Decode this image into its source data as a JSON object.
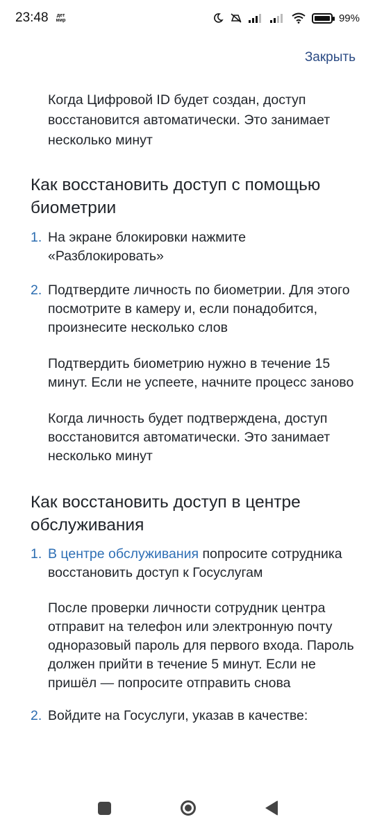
{
  "status_bar": {
    "time": "23:48",
    "notification_label": "дет мир",
    "battery": "99%"
  },
  "header": {
    "close_label": "Закрыть"
  },
  "intro": "Когда Цифровой ID будет создан, доступ восстановится автоматически. Это занимает несколько минут",
  "biometrics": {
    "heading": "Как восстановить доступ с помощью биометрии",
    "steps": [
      {
        "num": "1.",
        "text": "На экране блокировки нажмите «Разблокировать»"
      },
      {
        "num": "2.",
        "text": "Подтвердите личность по биометрии. Для этого посмотрите в камеру и, если понадобится, произнесите несколько слов"
      }
    ],
    "notes": [
      "Подтвердить биометрию нужно в течение 15 минут. Если не успеете, начните процесс заново",
      "Когда личность будет подтверждена, доступ восстановится автоматически. Это занимает несколько минут"
    ]
  },
  "service_center": {
    "heading": "Как восстановить доступ в центре обслуживания",
    "step1_num": "1.",
    "step1_link": "В центре обслуживания",
    "step1_rest": " попросите сотрудника восстановить доступ к Госуслугам",
    "note": "После проверки личности сотрудник центра отправит на телефон или электронную почту одноразовый пароль для первого входа. Пароль должен прийти в течение 5 минут. Если не пришёл — попросите отправить снова",
    "step2_num": "2.",
    "step2_text": "Войдите на Госуслуги, указав в качестве:"
  },
  "colors": {
    "link": "#2e6fb5",
    "text": "#1f2329",
    "accent_number": "#2b6cb0"
  }
}
